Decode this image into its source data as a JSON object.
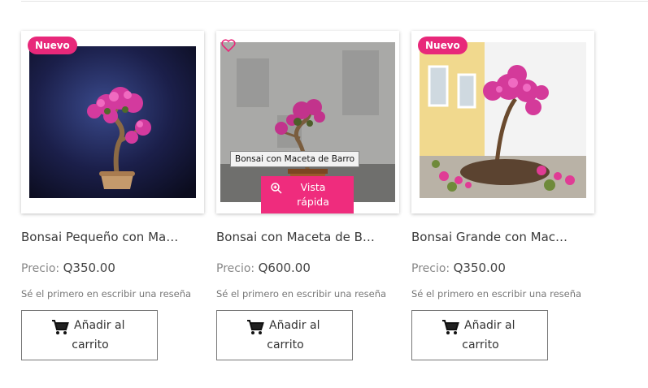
{
  "products": [
    {
      "name": "Bonsai Pequeño con Maceta",
      "badge": "Nuevo",
      "price_label": "Precio:",
      "price": "Q350.00",
      "review_text": "Sé el primero en escribir una reseña",
      "cart_line1": "Añadir al",
      "cart_line2": "carrito"
    },
    {
      "name": "Bonsai con Maceta de Barro",
      "tooltip": "Bonsai con Maceta de Barro",
      "quick_view_line1": "Vista",
      "quick_view_line2": "rápida",
      "price_label": "Precio:",
      "price": "Q600.00",
      "review_text": "Sé el primero en escribir una reseña",
      "cart_line1": "Añadir al",
      "cart_line2": "carrito"
    },
    {
      "name": "Bonsai Grande con Maceta",
      "badge": "Nuevo",
      "price_label": "Precio:",
      "price": "Q350.00",
      "review_text": "Sé el primero en escribir una reseña",
      "cart_line1": "Añadir al",
      "cart_line2": "carrito"
    }
  ],
  "colors": {
    "accent": "#ef2c7d",
    "badge": "#e8287a"
  }
}
